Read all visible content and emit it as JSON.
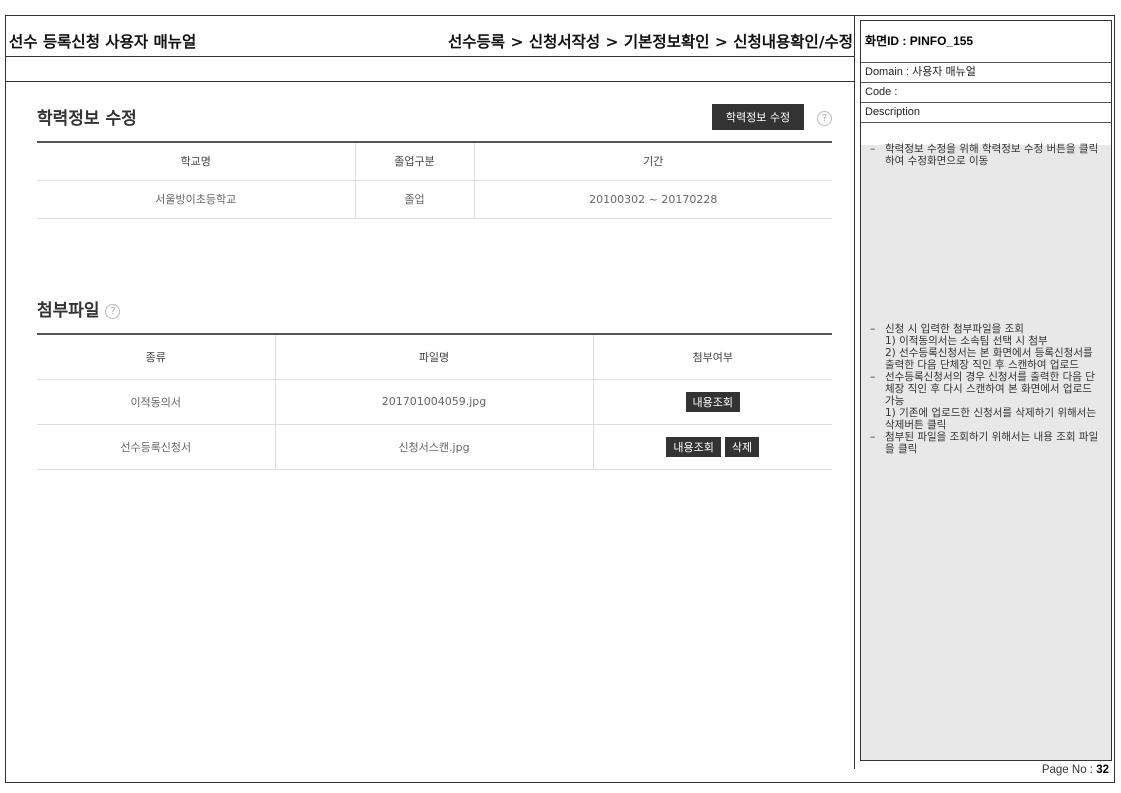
{
  "header": {
    "doc_title": "선수 등록신청 사용자 매뉴얼",
    "breadcrumb": "선수등록 > 신청서작성 > 기본정보확인 > 신청내용확인/수정"
  },
  "panel": {
    "screen_id": "화면ID : PINFO_155",
    "domain": "Domain : 사용자 매뉴얼",
    "code": "Code :",
    "description_label": "Description",
    "desc_block1": [
      "학력정보 수정을 위해 학력정보 수정 버튼을 클릭하여 수정화면으로 이동"
    ],
    "desc_block2": {
      "item1": "신청 시 입력한 첨부파일을 조회",
      "item1_sub1": "1) 이적동의서는 소속팀 선택 시 첨부",
      "item1_sub2": "2) 선수등록신청서는 본 화면에서 등록신청서를 출력한 다음 단체장 직인 후 스캔하여 업로드",
      "item2": "선수등록신청서의 경우 신청서를 출력한 다음 단체장 직인 후 다시 스캔하여 본 화면에서 업로드 가능",
      "item2_sub1": "1) 기존에 업로드한 신청서를 삭제하기 위해서는 삭제버튼 클릭",
      "item3": "첨부된 파일을 조회하기 위해서는 내용 조회 파일을 클릭"
    },
    "page_no_label": "Page No :",
    "page_no": "32"
  },
  "education": {
    "title": "학력정보 수정",
    "edit_button": "학력정보 수정",
    "help_icon": "?",
    "columns": [
      "학교명",
      "졸업구분",
      "기간"
    ],
    "rows": [
      {
        "school": "서울방이초등학교",
        "status": "졸업",
        "period": "20100302 ~ 20170228"
      }
    ]
  },
  "attachments": {
    "title": "첨부파일",
    "help_icon": "?",
    "columns": [
      "종류",
      "파일명",
      "첨부여부"
    ],
    "rows": [
      {
        "type": "이적동의서",
        "file": "201701004059.jpg",
        "view_button": "내용조회"
      },
      {
        "type": "선수등록신청서",
        "file": "신청서스캔.jpg",
        "view_button": "내용조회",
        "delete_button": "삭제"
      }
    ]
  }
}
